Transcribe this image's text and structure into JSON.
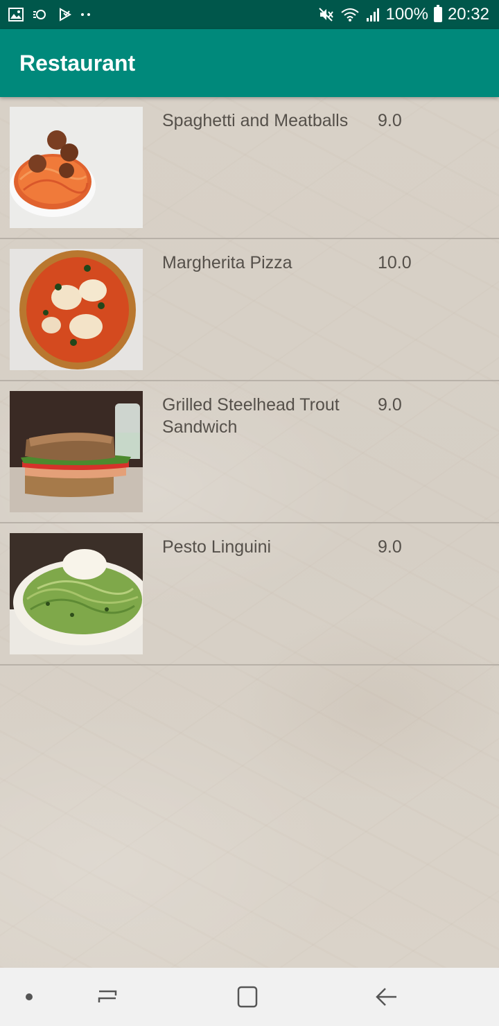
{
  "status_bar": {
    "battery_text": "100%",
    "time": "20:32",
    "left_icons": [
      "gallery-icon",
      "sync-icon",
      "download-icon",
      "more-dots-icon"
    ],
    "right_icons": [
      "mute-icon",
      "wifi-icon",
      "signal-icon",
      "battery-icon"
    ]
  },
  "app_bar": {
    "title": "Restaurant",
    "color": "#00897b"
  },
  "menu": {
    "items": [
      {
        "name": "Spaghetti and Meatballs",
        "price": "9.0",
        "image": "spaghetti-meatballs-photo"
      },
      {
        "name": "Margherita Pizza",
        "price": "10.0",
        "image": "margherita-pizza-photo"
      },
      {
        "name": "Grilled Steelhead Trout Sandwich",
        "price": "9.0",
        "image": "trout-sandwich-photo"
      },
      {
        "name": "Pesto Linguini",
        "price": "9.0",
        "image": "pesto-linguini-photo"
      }
    ]
  },
  "nav_bar": {
    "buttons": [
      "dot-icon",
      "recents-icon",
      "home-icon",
      "back-icon"
    ]
  }
}
